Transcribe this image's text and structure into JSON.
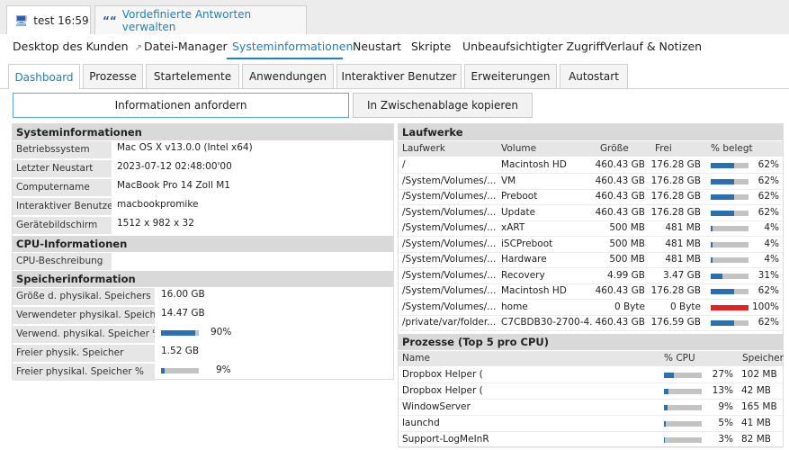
{
  "window_tabs": [
    {
      "label": "test 16:59"
    },
    {
      "label": "Vordefinierte Antworten verwalten"
    }
  ],
  "nav": [
    "Desktop des Kunden",
    "Datei-Manager",
    "Systeminformationen",
    "Neustart",
    "Skripte",
    "Unbeaufsichtigter Zugriff",
    "Verlauf & Notizen"
  ],
  "nav_active": "Systeminformationen",
  "sub_tabs": [
    "Dashboard",
    "Prozesse",
    "Startelemente",
    "Anwendungen",
    "Interaktiver Benutzer",
    "Erweiterungen",
    "Autostart"
  ],
  "sub_tab_active": "Dashboard",
  "buttons": {
    "request": "Informationen anfordern",
    "copy": "In Zwischenablage kopieren"
  },
  "sysinfo": {
    "title": "Systeminformationen",
    "rows": [
      {
        "label": "Betriebssystem",
        "value": "Mac OS X v13.0.0 (Intel x64)"
      },
      {
        "label": "Letzter Neustart",
        "value": "2023-07-12 02:48:00'00"
      },
      {
        "label": "Computername",
        "value": "MacBook Pro 14 Zoll M1"
      },
      {
        "label": "Interaktiver Benutzer",
        "value": "macbookpromike"
      },
      {
        "label": "Gerätebildschirm",
        "value": "1512 x 982 x 32"
      }
    ]
  },
  "cpu": {
    "title": "CPU-Informationen",
    "label": "CPU-Beschreibung",
    "value": ""
  },
  "memory": {
    "title": "Speicherinformation",
    "rows": [
      {
        "label": "Größe d. physikal. Speichers",
        "value": "16.00 GB"
      },
      {
        "label": "Verwendeter physikal. Speicher",
        "value": "14.47 GB"
      },
      {
        "label": "Verwend. physikal. Speicher %",
        "value": "90%",
        "percent": 90
      },
      {
        "label": "Freier physik. Speicher",
        "value": "1.52 GB"
      },
      {
        "label": "Freier physikal. Speicher %",
        "value": "9%",
        "percent": 9
      }
    ]
  },
  "drives": {
    "title": "Laufwerke",
    "headers": [
      "Laufwerk",
      "Volume",
      "Größe",
      "Frei",
      "% belegt"
    ],
    "rows": [
      {
        "drive": "/",
        "volume": "Macintosh HD",
        "size": "460.43 GB",
        "free": "176.28 GB",
        "pct": "62%",
        "percent": 62
      },
      {
        "drive": "/System/Volumes/...",
        "volume": "VM",
        "size": "460.43 GB",
        "free": "176.28 GB",
        "pct": "62%",
        "percent": 62
      },
      {
        "drive": "/System/Volumes/...",
        "volume": "Preboot",
        "size": "460.43 GB",
        "free": "176.28 GB",
        "pct": "62%",
        "percent": 62
      },
      {
        "drive": "/System/Volumes/...",
        "volume": "Update",
        "size": "460.43 GB",
        "free": "176.28 GB",
        "pct": "62%",
        "percent": 62
      },
      {
        "drive": "/System/Volumes/...",
        "volume": "xART",
        "size": "500 MB",
        "free": "481 MB",
        "pct": "4%",
        "percent": 4
      },
      {
        "drive": "/System/Volumes/...",
        "volume": "iSCPreboot",
        "size": "500 MB",
        "free": "481 MB",
        "pct": "4%",
        "percent": 4
      },
      {
        "drive": "/System/Volumes/...",
        "volume": "Hardware",
        "size": "500 MB",
        "free": "481 MB",
        "pct": "4%",
        "percent": 4
      },
      {
        "drive": "/System/Volumes/...",
        "volume": "Recovery",
        "size": "4.99 GB",
        "free": "3.47 GB",
        "pct": "31%",
        "percent": 31
      },
      {
        "drive": "/System/Volumes/...",
        "volume": "Macintosh HD",
        "size": "460.43 GB",
        "free": "176.28 GB",
        "pct": "62%",
        "percent": 62
      },
      {
        "drive": "/System/Volumes/...",
        "volume": "home",
        "size": "0 Byte",
        "free": "0 Byte",
        "pct": "100%",
        "percent": 100
      },
      {
        "drive": "/private/var/folder...",
        "volume": "C7CBDB30-2700-4...",
        "size": "460.43 GB",
        "free": "176.59 GB",
        "pct": "62%",
        "percent": 62
      }
    ]
  },
  "processes": {
    "title": "Prozesse (Top 5 pro CPU)",
    "headers": [
      "Name",
      "% CPU",
      "Speicher"
    ],
    "rows": [
      {
        "name": "Dropbox Helper (",
        "cpu": "27%",
        "percent": 27,
        "mem": "102 MB"
      },
      {
        "name": "Dropbox Helper (",
        "cpu": "13%",
        "percent": 13,
        "mem": "42 MB"
      },
      {
        "name": "WindowServer",
        "cpu": "9%",
        "percent": 9,
        "mem": "165 MB"
      },
      {
        "name": "launchd",
        "cpu": "5%",
        "percent": 5,
        "mem": "41 MB"
      },
      {
        "name": "Support-LogMeInR",
        "cpu": "3%",
        "percent": 3,
        "mem": "82 MB"
      }
    ]
  },
  "colors": {
    "accent": "#1f7fc0",
    "bar_fill": "#2b6fae",
    "bar_full": "#e02323",
    "bar_track": "#c3c3c3"
  }
}
